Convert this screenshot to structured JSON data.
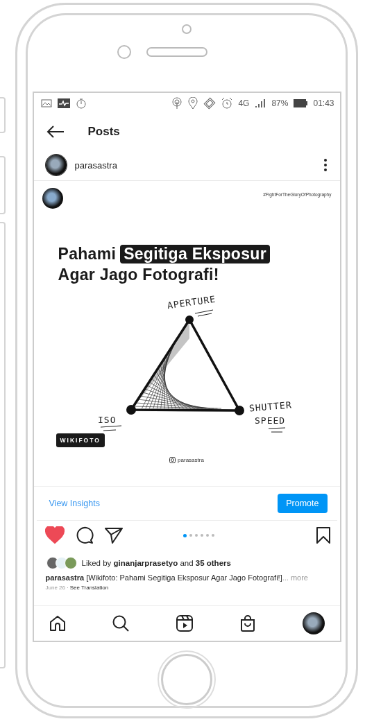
{
  "status_bar": {
    "network": "4G",
    "battery": "87%",
    "time": "01:43"
  },
  "header": {
    "title": "Posts"
  },
  "author": {
    "username": "parasastra"
  },
  "post_image": {
    "hashtag": "#FightForTheGloryOfPhotography",
    "title_lines": [
      [
        {
          "text": "Pahami",
          "highlight": false
        },
        {
          "text": "Segitiga Eksposur",
          "highlight": true
        }
      ],
      [
        {
          "text": "Agar Jago Fotografi!",
          "highlight": false
        }
      ]
    ],
    "diagram_labels": {
      "top": "APERTURE",
      "left": "ISO",
      "right": [
        "SHUTTER",
        "SPEED"
      ]
    },
    "badge": "WIKIFOTO",
    "handle": "parasastra"
  },
  "insights": {
    "link": "View Insights",
    "button": "Promote"
  },
  "actions": {
    "liked": true,
    "saved": false
  },
  "carousel_dots": [
    {
      "selected": true
    },
    {
      "selected": false
    },
    {
      "selected": false
    },
    {
      "selected": false
    },
    {
      "selected": false
    },
    {
      "selected": false
    }
  ],
  "likes": {
    "text": "Liked by **ginanjarprasetyo** and **35 others**"
  },
  "caption": {
    "username": "parasastra",
    "text": "[Wikifoto: Pahami Segitiga Eksposur Agar Jago Fotografi!]",
    "more": "... more"
  },
  "meta": {
    "date": "June 26",
    "separator": "·",
    "translate": "See Translation"
  },
  "bottom_nav": [
    {
      "kind": "home"
    },
    {
      "kind": "search"
    },
    {
      "kind": "reels"
    },
    {
      "kind": "shop"
    },
    {
      "kind": "profile"
    }
  ]
}
